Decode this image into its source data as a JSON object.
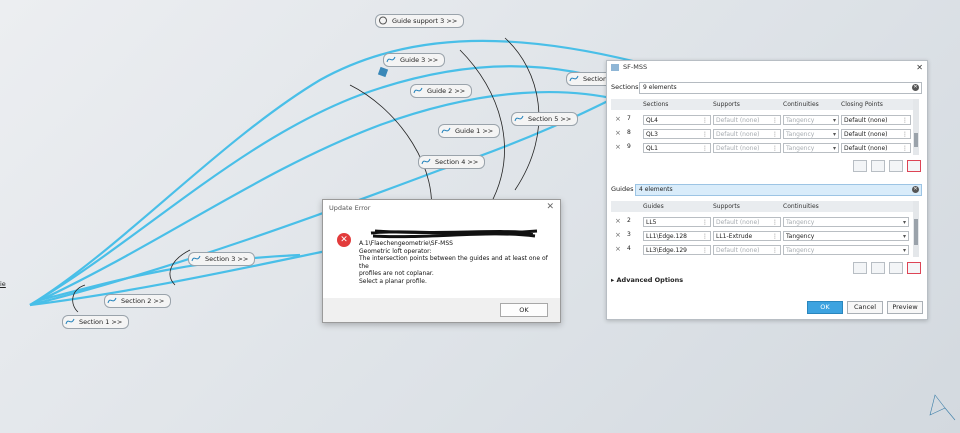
{
  "viewport_tags": {
    "guide_support_3": "Guide support 3 >>",
    "guide_3": "Guide 3 >>",
    "guide_2": "Guide 2 >>",
    "guide_1": "Guide 1 >>",
    "section_5": "Section 5 >>",
    "section_4": "Section 4 >>",
    "section_3": "Section 3 >>",
    "section_2": "Section 2 >>",
    "section_1": "Section 1 >>",
    "section_partial": "Section"
  },
  "edge_label": "ie",
  "error_dialog": {
    "title": "Update Error",
    "icon": "error-x-icon",
    "lines": [
      "A.1\\Flaechengeometrie\\SF-MSS",
      "Geometric loft operator:",
      "The intersection points between the guides and at least one of the",
      "profiles are not coplanar.",
      "Select a planar profile."
    ],
    "ok_label": "OK"
  },
  "panel": {
    "title": "SF-MSS",
    "sections_label": "Sections",
    "sections_count": "9 elements",
    "sections_headers": [
      "Sections",
      "Supports",
      "Continuities",
      "Closing Points"
    ],
    "sections_rows": [
      {
        "n": "7",
        "name": "QL4",
        "support": "Default (none)",
        "cont": "Tangency",
        "closing": "Default (none)"
      },
      {
        "n": "8",
        "name": "QL3",
        "support": "Default (none)",
        "cont": "Tangency",
        "closing": "Default (none)"
      },
      {
        "n": "9",
        "name": "QL1",
        "support": "Default (none)",
        "cont": "Tangency",
        "closing": "Default (none)"
      }
    ],
    "guides_label": "Guides",
    "guides_count": "4 elements",
    "guides_headers": [
      "Guides",
      "Supports",
      "Continuities"
    ],
    "guides_rows": [
      {
        "n": "2",
        "name": "LL5",
        "support": "Default (none)",
        "cont": "Tangency"
      },
      {
        "n": "3",
        "name": "LL1\\Edge.128",
        "support": "LL1-Extrude",
        "cont": "Tangency"
      },
      {
        "n": "4",
        "name": "LL3\\Edge.129",
        "support": "Default (none)",
        "cont": "Tangency"
      }
    ],
    "advanced": "Advanced Options",
    "ok": "OK",
    "cancel": "Cancel",
    "preview": "Preview"
  },
  "colors": {
    "curve": "#49bfe8",
    "accent": "#3da3e0",
    "error": "#e23b3b"
  }
}
